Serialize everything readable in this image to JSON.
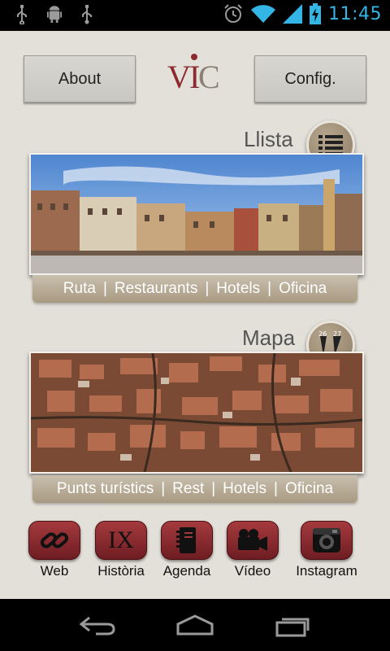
{
  "status_bar": {
    "time": "11:45",
    "icons": [
      "usb-icon",
      "android-debug-icon",
      "usb-icon",
      "alarm-icon",
      "wifi-icon",
      "signal-icon",
      "battery-charging-icon"
    ]
  },
  "header": {
    "about_label": "About",
    "config_label": "Config.",
    "logo_icon": "vic-logo"
  },
  "list_section": {
    "title": "Llista",
    "icon": "list-icon",
    "links": [
      "Ruta",
      "Restaurants",
      "Hotels",
      "Oficina"
    ]
  },
  "map_section": {
    "title": "Mapa",
    "icon": "map-pins-icon",
    "pin_labels": [
      "26",
      "27"
    ],
    "links": [
      "Punts turístics",
      "Rest",
      "Hotels",
      "Oficina"
    ]
  },
  "app_icons": [
    {
      "label": "Web",
      "icon": "link-icon"
    },
    {
      "label": "Història",
      "icon": "roman-numeral-icon",
      "glyph": "IX"
    },
    {
      "label": "Agenda",
      "icon": "notebook-icon"
    },
    {
      "label": "Vídeo",
      "icon": "video-camera-icon"
    },
    {
      "label": "Instagram",
      "icon": "camera-icon"
    }
  ],
  "colors": {
    "background": "#e3e0d9",
    "accent_red": "#8c2a2f",
    "link_bar": "#b3a68f",
    "status_blue": "#33b5e5"
  }
}
